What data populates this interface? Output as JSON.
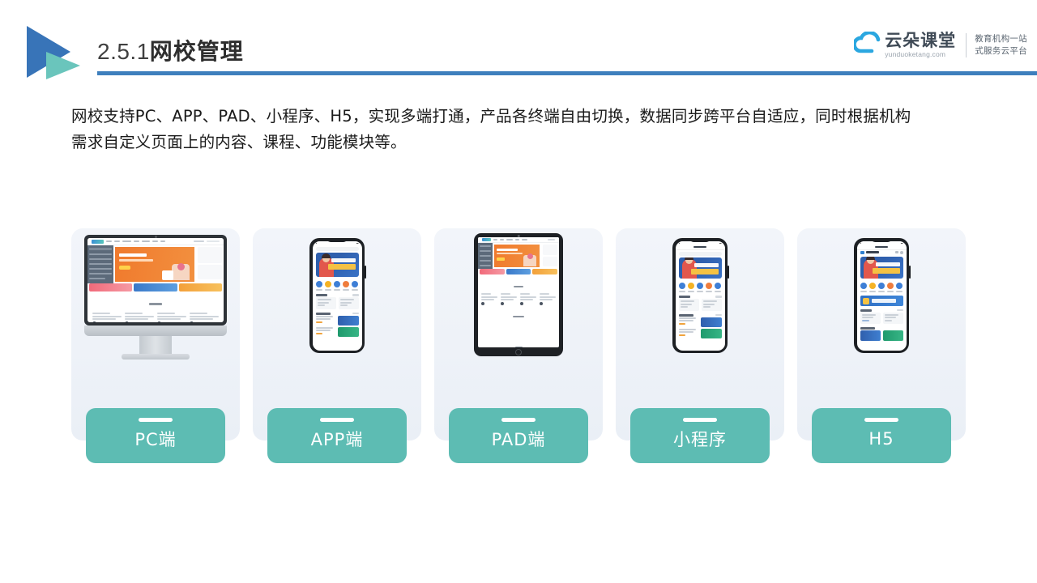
{
  "header": {
    "title_number": "2.5.1",
    "title_text": "网校管理",
    "logo_icon": "double-triangle-logo",
    "rule_color": "#3e7fbd"
  },
  "brand": {
    "icon": "cloud-icon",
    "name_cn": "云朵课堂",
    "url": "yunduoketang.com",
    "tagline_line1": "教育机构一站",
    "tagline_line2": "式服务云平台"
  },
  "body": {
    "paragraph_line1": "网校支持PC、APP、PAD、小程序、H5，实现多端打通，产品各终端自由切换，数据同步跨平台自适应，同时根据机构",
    "paragraph_line2": "需求自定义页面上的内容、课程、功能模块等。"
  },
  "cards": [
    {
      "label": "PC端",
      "device": "desktop-monitor",
      "screenshot": "网校PC端首页"
    },
    {
      "label": "APP端",
      "device": "smartphone",
      "screenshot": "网校APP首页"
    },
    {
      "label": "PAD端",
      "device": "tablet",
      "screenshot": "网校PAD端首页"
    },
    {
      "label": "小程序",
      "device": "smartphone",
      "screenshot": "网校小程序首页"
    },
    {
      "label": "H5",
      "device": "smartphone",
      "screenshot": "网校H5页面"
    }
  ],
  "colors": {
    "accent_teal": "#5dbcb3",
    "accent_blue": "#3e7fbd",
    "card_bg": "#eef2f8",
    "logo_blue": "#3874b8",
    "logo_teal": "#6ac5bc"
  }
}
